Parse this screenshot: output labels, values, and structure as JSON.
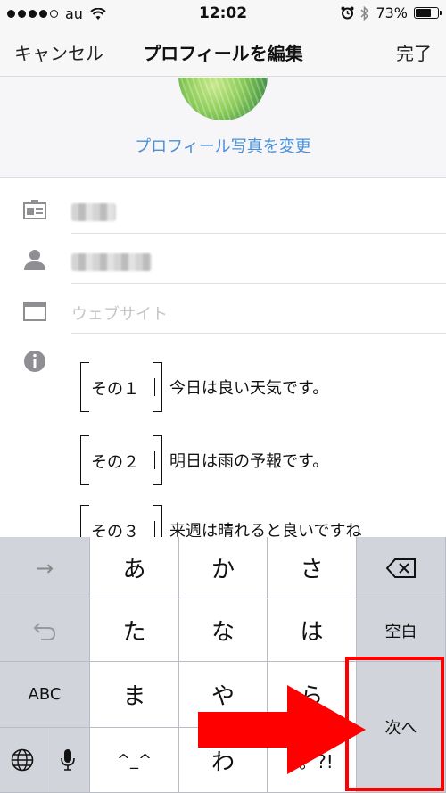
{
  "status_bar": {
    "carrier": "au",
    "time": "12:02",
    "battery": "73%",
    "battery_level": 0.73
  },
  "nav": {
    "cancel": "キャンセル",
    "title": "プロフィールを編集",
    "done": "完了"
  },
  "profile": {
    "change_photo": "プロフィール写真を変更"
  },
  "form": {
    "website_placeholder": "ウェブサイト",
    "bio_lines": [
      {
        "tag": "その１",
        "text": "今日は良い天気です。"
      },
      {
        "tag": "その２",
        "text": "明日は雨の予報です。"
      },
      {
        "tag": "その３",
        "text": "来週は晴れると良いですね"
      }
    ]
  },
  "keyboard": {
    "arrow": "→",
    "a": "あ",
    "ka": "か",
    "sa": "さ",
    "ta": "た",
    "na": "な",
    "ha": "は",
    "space": "空白",
    "abc": "ABC",
    "ma": "ま",
    "ya": "や",
    "ra": "ら",
    "emoticon": "^_^",
    "wa": "わ",
    "punct": "、。?!",
    "next": "次へ"
  },
  "annotation": {
    "arrow_color": "#ff0000",
    "box_color": "#ff0000"
  }
}
